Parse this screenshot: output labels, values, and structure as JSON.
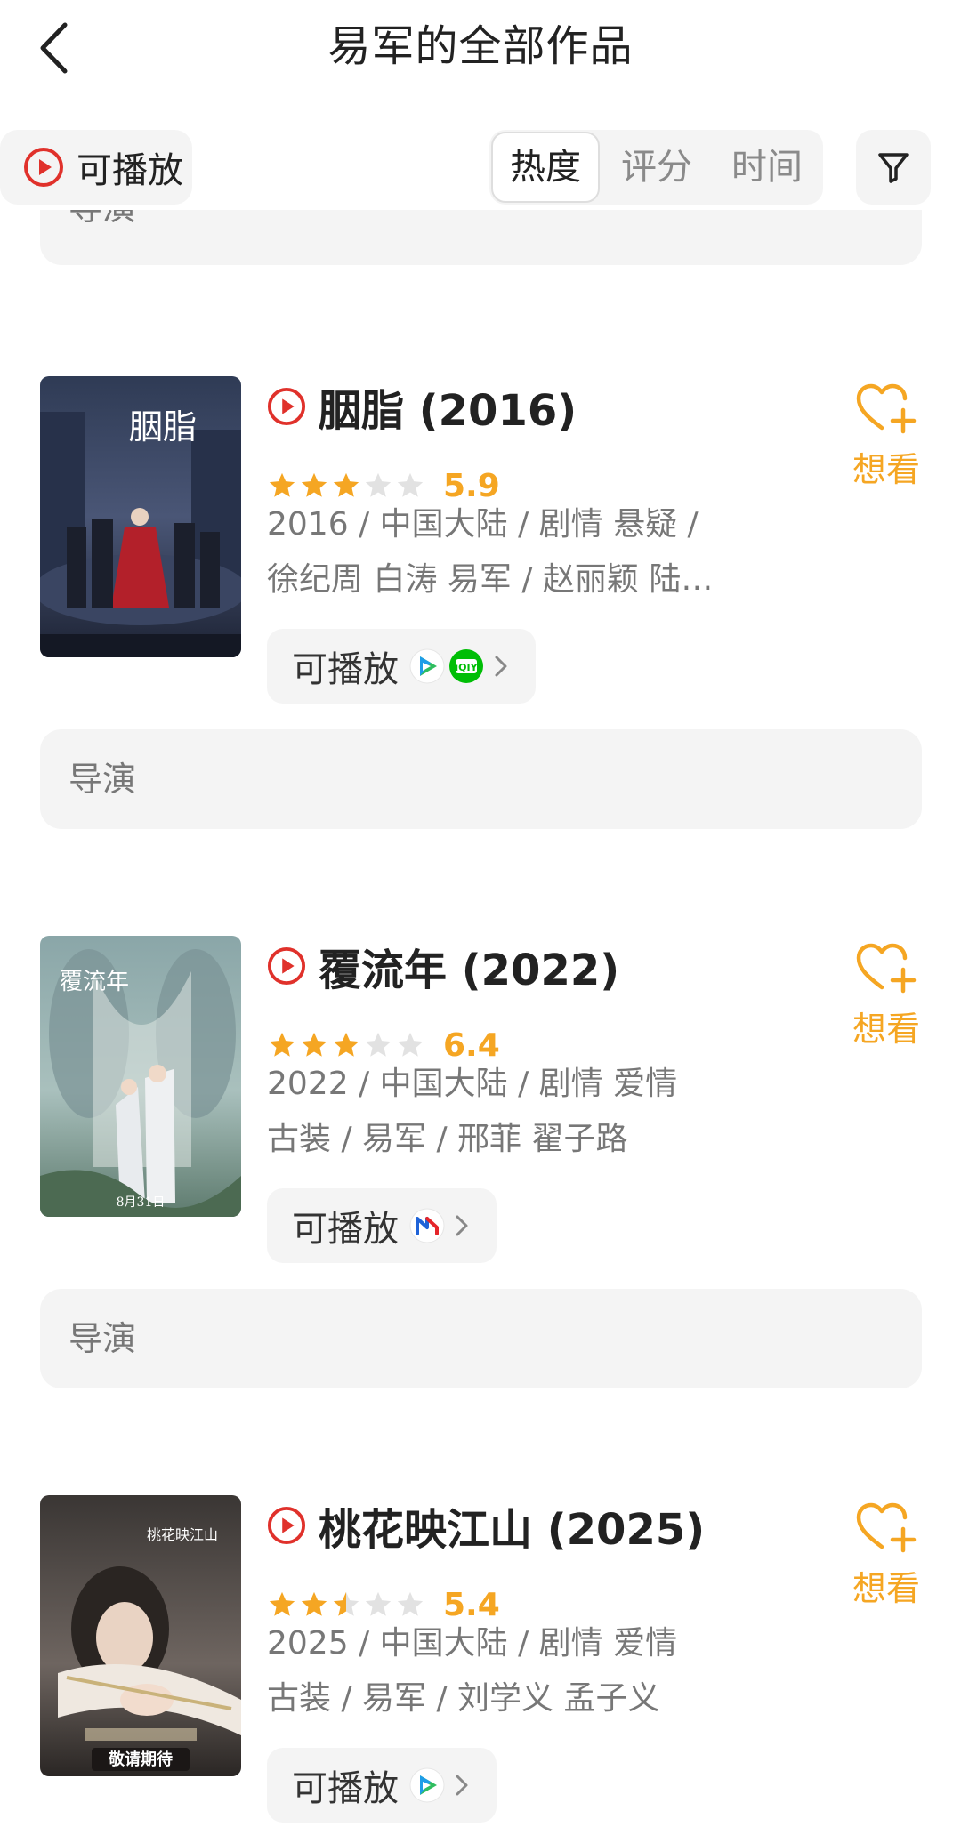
{
  "header": {
    "title": "易军的全部作品",
    "back_icon": "chevron-left-icon"
  },
  "filter": {
    "playable_label": "可播放",
    "sort_options": [
      "热度",
      "评分",
      "时间"
    ],
    "active_sort": "热度",
    "filter_icon": "funnel-icon"
  },
  "director_label": "导演",
  "movies": [
    {
      "title": "胭脂 (2016)",
      "stars": 3,
      "score": "5.9",
      "info_line1": "2016 / 中国大陆 / 剧情 悬疑 /",
      "info_line2": "徐纪周 白涛 易军 / 赵丽颖 陆…",
      "play_label": "可播放",
      "platforms": [
        "tencent-video-icon",
        "iqiyi-icon"
      ],
      "want_label": "想看",
      "poster_text": "胭脂"
    },
    {
      "title": "覆流年 (2022)",
      "stars": 3,
      "score": "6.4",
      "info_line1": "2022 / 中国大陆 / 剧情 爱情",
      "info_line2": "古装 / 易军 / 邢菲 翟子路",
      "play_label": "可播放",
      "platforms": [
        "mgtv-icon"
      ],
      "want_label": "想看",
      "poster_text": "覆流年",
      "poster_date": "8月31日"
    },
    {
      "title": "桃花映江山 (2025)",
      "stars": 2.5,
      "score": "5.4",
      "info_line1": "2025 / 中国大陆 / 剧情 爱情",
      "info_line2": "古装 / 易军 / 刘学义 孟子义",
      "play_label": "可播放",
      "platforms": [
        "tencent-video-icon"
      ],
      "want_label": "想看",
      "poster_text": "桃花映江山",
      "poster_caption": "敬请期待"
    }
  ],
  "colors": {
    "accent": "#f5a623",
    "play_red": "#e0312b",
    "star_empty": "#e2e2e2",
    "pill_bg": "#f4f4f4"
  }
}
